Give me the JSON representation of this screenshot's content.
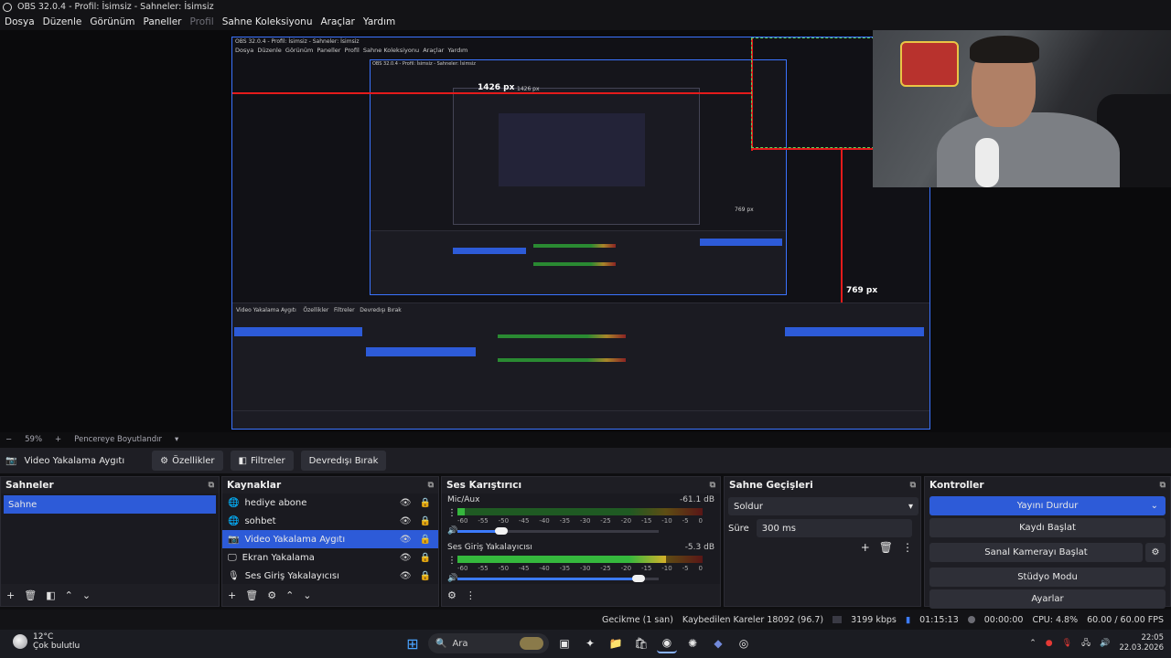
{
  "window": {
    "title": "OBS 32.0.4 - Profil: İsimsiz - Sahneler: İsimsiz"
  },
  "menu": {
    "items": [
      "Dosya",
      "Düzenle",
      "Görünüm",
      "Paneller",
      "Profil",
      "Sahne Koleksiyonu",
      "Araçlar",
      "Yardım"
    ],
    "disabled_index": 4
  },
  "preview": {
    "labels": {
      "width_px": "1426 px",
      "height_px": "769 px"
    },
    "nested_labels": {
      "width_px_small": "1426 px",
      "height_px_small": "769 px"
    },
    "nested_title": "OBS 32.0.4 - Profil: İsimsiz - Sahneler: İsimsiz"
  },
  "zoom": {
    "minus": "−",
    "value": "59%",
    "plus": "+",
    "resize_label": "Pencereye Boyutlandır"
  },
  "toolbar": {
    "source_name": "Video Yakalama Aygıtı",
    "properties": "Özellikler",
    "filters": "Filtreler",
    "deactivate": "Devredışı Bırak"
  },
  "scenes": {
    "title": "Sahneler",
    "items": [
      "Sahne"
    ]
  },
  "sources": {
    "title": "Kaynaklar",
    "items": [
      {
        "label": "hediye abone",
        "icon": "globe-icon"
      },
      {
        "label": "sohbet",
        "icon": "globe-icon"
      },
      {
        "label": "Video Yakalama Aygıtı",
        "icon": "camera-icon",
        "selected": true
      },
      {
        "label": "Ekran Yakalama",
        "icon": "monitor-icon"
      },
      {
        "label": "Ses Giriş Yakalayıcısı",
        "icon": "mic-icon"
      }
    ]
  },
  "mixer": {
    "title": "Ses Karıştırıcı",
    "channels": [
      {
        "name": "Mic/Aux",
        "db": "-61.1 dB",
        "level": 0.03,
        "volume": 0.22
      },
      {
        "name": "Ses Giriş Yakalayıcısı",
        "db": "-5.3 dB",
        "level": 0.85,
        "volume": 0.9
      }
    ],
    "scale": [
      "-60",
      "-55",
      "-50",
      "-45",
      "-40",
      "-35",
      "-30",
      "-25",
      "-20",
      "-15",
      "-10",
      "-5",
      "0"
    ]
  },
  "transitions": {
    "title": "Sahne Geçişleri",
    "selected": "Soldur",
    "duration_label": "Süre",
    "duration_value": "300 ms"
  },
  "controls": {
    "title": "Kontroller",
    "buttons": [
      "Yayını Durdur",
      "Kaydı Başlat",
      "Sanal Kamerayı Başlat",
      "Stüdyo Modu",
      "Ayarlar"
    ]
  },
  "status": {
    "delay": "Gecikme (1 san)",
    "dropped": "Kaybedilen Kareler 18092 (96.7)",
    "bitrate": "3199 kbps",
    "stream_time": "01:15:13",
    "rec_time": "00:00:00",
    "cpu": "CPU: 4.8%",
    "fps": "60.00 / 60.00 FPS"
  },
  "taskbar": {
    "weather_temp": "12°C",
    "weather_desc": "Çok bulutlu",
    "search": "Ara",
    "time": "22:05",
    "date": "22.03.2026"
  },
  "colors": {
    "accent": "#2d5bd8",
    "outline": "#3b73ff",
    "red_guide": "#e41b1b"
  }
}
